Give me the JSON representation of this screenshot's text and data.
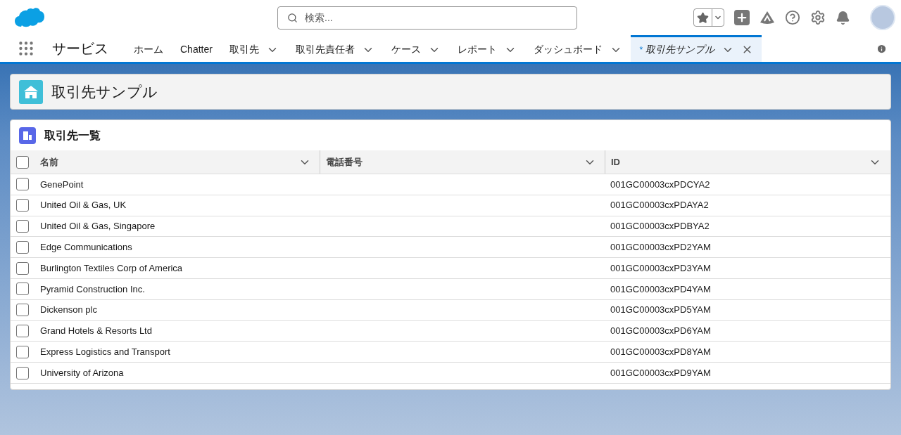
{
  "search": {
    "placeholder": "検索..."
  },
  "app_name": "サービス",
  "tabs": [
    {
      "label": "ホーム",
      "menu": false,
      "selected": false
    },
    {
      "label": "Chatter",
      "menu": false,
      "selected": false
    },
    {
      "label": "取引先",
      "menu": true,
      "selected": false
    },
    {
      "label": "取引先責任者",
      "menu": true,
      "selected": false
    },
    {
      "label": "ケース",
      "menu": true,
      "selected": false
    },
    {
      "label": "レポート",
      "menu": true,
      "selected": false
    },
    {
      "label": "ダッシュボード",
      "menu": true,
      "selected": false
    },
    {
      "label": "取引先サンプル",
      "unsaved_mark": "*",
      "menu": true,
      "closable": true,
      "selected": true
    }
  ],
  "page_header": {
    "title": "取引先サンプル"
  },
  "list": {
    "title": "取引先一覧",
    "columns": [
      "名前",
      "電話番号",
      "ID"
    ],
    "select_all": {
      "checked": false
    },
    "rows": [
      {
        "name": "GenePoint",
        "phone": "",
        "id": "001GC00003cxPDCYA2",
        "checked": false
      },
      {
        "name": "United Oil & Gas, UK",
        "phone": "",
        "id": "001GC00003cxPDAYA2",
        "checked": false
      },
      {
        "name": "United Oil & Gas, Singapore",
        "phone": "",
        "id": "001GC00003cxPDBYA2",
        "checked": false
      },
      {
        "name": "Edge Communications",
        "phone": "",
        "id": "001GC00003cxPD2YAM",
        "checked": false
      },
      {
        "name": "Burlington Textiles Corp of America",
        "phone": "",
        "id": "001GC00003cxPD3YAM",
        "checked": false
      },
      {
        "name": "Pyramid Construction Inc.",
        "phone": "",
        "id": "001GC00003cxPD4YAM",
        "checked": false
      },
      {
        "name": "Dickenson plc",
        "phone": "",
        "id": "001GC00003cxPD5YAM",
        "checked": false
      },
      {
        "name": "Grand Hotels & Resorts Ltd",
        "phone": "",
        "id": "001GC00003cxPD6YAM",
        "checked": false
      },
      {
        "name": "Express Logistics and Transport",
        "phone": "",
        "id": "001GC00003cxPD8YAM",
        "checked": false
      },
      {
        "name": "University of Arizona",
        "phone": "",
        "id": "001GC00003cxPD9YAM",
        "checked": false
      }
    ]
  }
}
